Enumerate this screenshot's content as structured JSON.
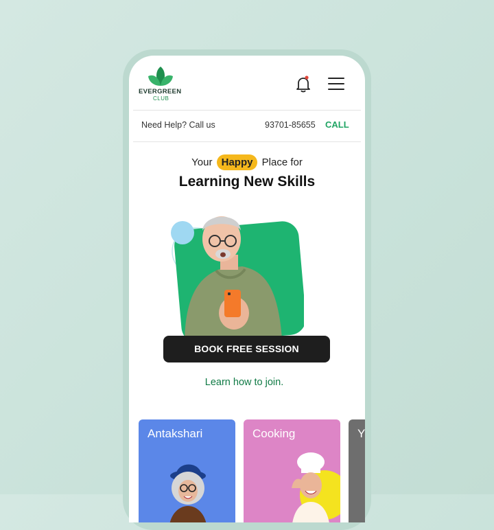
{
  "brand": {
    "line1": "EVERGREEN",
    "line2": "CLUB"
  },
  "icons": {
    "logo": "leaf-logo-icon",
    "bell": "bell-icon",
    "menu": "hamburger-menu-icon"
  },
  "helpbar": {
    "need_help": "Need Help?  Call us",
    "phone": "93701-85655",
    "call_label": "CALL"
  },
  "hero": {
    "tagline_before": "Your",
    "tagline_highlight": "Happy",
    "tagline_after": "Place  for",
    "headline": "Learning New Skills",
    "cta_label": "BOOK FREE SESSION",
    "learn_link": "Learn how to join."
  },
  "cards": [
    {
      "title": "Antakshari"
    },
    {
      "title": "Cooking"
    },
    {
      "title": "Y"
    }
  ],
  "colors": {
    "accent_green": "#1fa463",
    "highlight": "#f5b81c",
    "card_blue": "#5b87e8",
    "card_pink": "#dd85c6"
  }
}
